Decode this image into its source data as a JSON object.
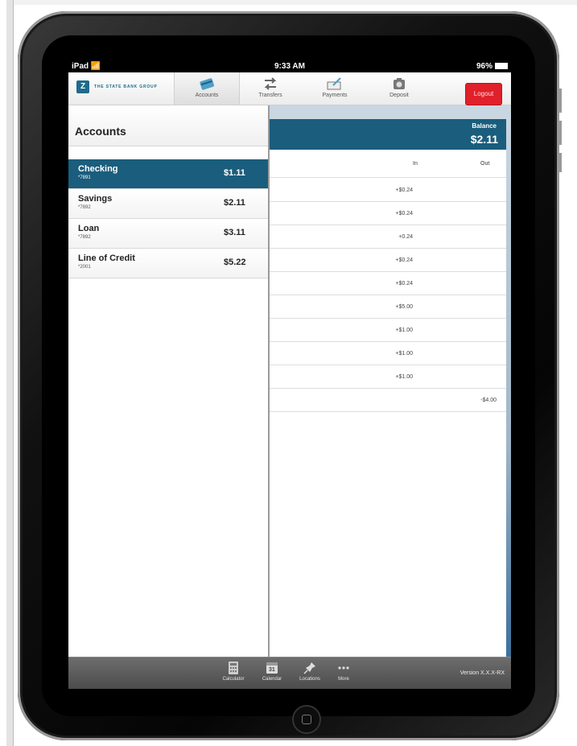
{
  "status": {
    "device": "iPad",
    "time": "9:33 AM",
    "battery": "96%"
  },
  "logo": {
    "text": "THE STATE BANK GROUP"
  },
  "nav": [
    {
      "label": "Accounts",
      "icon": "card-icon",
      "active": true
    },
    {
      "label": "Transfers",
      "icon": "transfer-arrows-icon",
      "active": false
    },
    {
      "label": "Payments",
      "icon": "check-pen-icon",
      "active": false
    },
    {
      "label": "Deposit",
      "icon": "camera-icon",
      "active": false
    }
  ],
  "logout_label": "Logout",
  "accounts_title": "Accounts",
  "accounts": [
    {
      "name": "Checking",
      "number": "*7891",
      "balance": "$1.11",
      "selected": true
    },
    {
      "name": "Savings",
      "number": "*7892",
      "balance": "$2.11",
      "selected": false
    },
    {
      "name": "Loan",
      "number": "*7892",
      "balance": "$3.11",
      "selected": false
    },
    {
      "name": "Line of Credit",
      "number": "*2001",
      "balance": "$5.22",
      "selected": false
    }
  ],
  "balance": {
    "label": "Balance",
    "value": "$2.11"
  },
  "tx_headers": {
    "in": "In",
    "out": "Out"
  },
  "transactions": [
    {
      "in": "+$0.24",
      "out": ""
    },
    {
      "in": "+$0.24",
      "out": ""
    },
    {
      "in": "+0.24",
      "out": ""
    },
    {
      "in": "+$0.24",
      "out": ""
    },
    {
      "in": "+$0.24",
      "out": ""
    },
    {
      "in": "+$5.00",
      "out": ""
    },
    {
      "in": "+$1.00",
      "out": ""
    },
    {
      "in": "+$1.00",
      "out": ""
    },
    {
      "in": "+$1.00",
      "out": ""
    },
    {
      "in": "",
      "out": "-$4.00"
    }
  ],
  "tools": [
    {
      "label": "Calculator",
      "icon": "calculator-icon"
    },
    {
      "label": "Calendar",
      "icon": "calendar-icon",
      "day": "31"
    },
    {
      "label": "Locations",
      "icon": "pushpin-icon"
    },
    {
      "label": "More",
      "icon": "more-dots-icon"
    }
  ],
  "version": "Version X.X.X-RX",
  "colors": {
    "accent": "#1a5d7d",
    "logout": "#e0202a"
  }
}
